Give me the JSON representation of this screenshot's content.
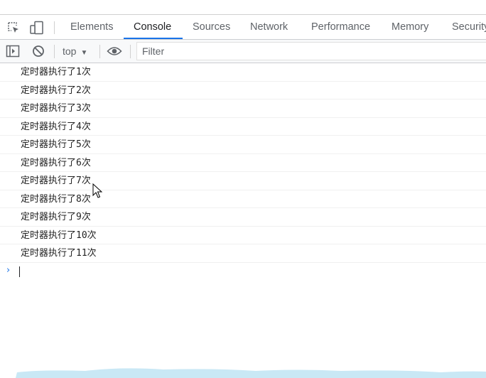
{
  "devtools": {
    "tabs": [
      {
        "label": "Elements"
      },
      {
        "label": "Console"
      },
      {
        "label": "Sources"
      },
      {
        "label": "Network"
      },
      {
        "label": "Performance"
      },
      {
        "label": "Memory"
      },
      {
        "label": "Security"
      }
    ],
    "active_tab": "Console",
    "icons": {
      "inspect": "inspect-element-icon",
      "device": "device-toolbar-icon",
      "sidebar": "show-sidebar-icon",
      "clear": "clear-console-icon",
      "eye": "live-expression-icon"
    }
  },
  "toolbar": {
    "context": "top",
    "filter_placeholder": "Filter"
  },
  "console": {
    "logs": [
      "定时器执行了1次",
      "定时器执行了2次",
      "定时器执行了3次",
      "定时器执行了4次",
      "定时器执行了5次",
      "定时器执行了6次",
      "定时器执行了7次",
      "定时器执行了8次",
      "定时器执行了9次",
      "定时器执行了10次",
      "定时器执行了11次"
    ],
    "prompt": "›"
  },
  "colors": {
    "accent": "#1a73e8",
    "toolbar_bg": "#f8f9fa",
    "text": "#202124",
    "muted": "#5f6368"
  }
}
